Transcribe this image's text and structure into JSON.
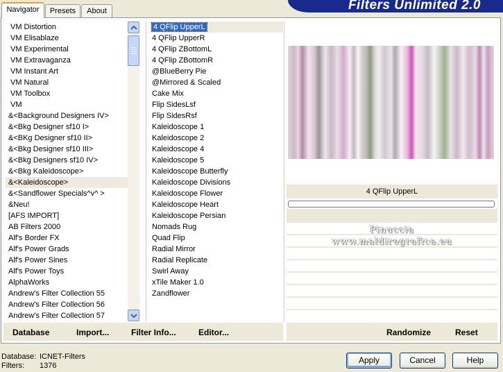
{
  "tabs": [
    {
      "label": "Navigator"
    },
    {
      "label": "Presets"
    },
    {
      "label": "About"
    }
  ],
  "banner": {
    "title": "Filters Unlimited 2.0"
  },
  "categories": {
    "selected_index": 14,
    "items": [
      "VM Distortion",
      "VM Elisablaze",
      "VM Experimental",
      "VM Extravaganza",
      "VM Instant Art",
      "VM Natural",
      "VM Toolbox",
      "VM",
      "&<Background Designers IV>",
      "&<Bkg Designer sf10 I>",
      "&<BKg Designer sf10 II>",
      "&<Bkg Designer sf10 III>",
      "&<Bkg Designers sf10 IV>",
      "&<Bkg Kaleidoscope>",
      "&<Kaleidoscope>",
      "&<Sandflower Specials^v^ >",
      "&Neu!",
      "[AFS IMPORT]",
      "AB Filters 2000",
      "Alf's Border FX",
      "Alf's Power Grads",
      "Alf's Power Sines",
      "Alf's Power Toys",
      "AlphaWorks",
      "Andrew's Filter Collection 55",
      "Andrew's Filter Collection 56",
      "Andrew's Filter Collection 57"
    ]
  },
  "filters": {
    "selected_index": 0,
    "items": [
      "4 QFlip UpperL",
      "4 QFlip UpperR",
      "4 QFlip ZBottomL",
      "4 QFlip ZBottomR",
      "@BlueBerry Pie",
      "@Mirrored & Scaled",
      "Cake Mix",
      "Flip SidesLsf",
      "Flip SidesRsf",
      "Kaleidoscope 1",
      "Kaleidoscope 2",
      "Kaleidoscope 4",
      "Kaleidoscope 5",
      "Kaleidoscope Butterfly",
      "Kaleidoscope Divisions",
      "Kaleidoscope Flower",
      "Kaleidoscope Heart",
      "Kaleidoscope Persian",
      "Nomads Rug",
      "Quad Flip",
      "Radial Mirror",
      "Radial Replicate",
      "Swirl Away",
      "xTile Maker 1.0",
      "Zandflower"
    ]
  },
  "preview": {
    "filter_name": "4 QFlip UpperL",
    "progress": 0
  },
  "watermark": {
    "line1": "Pinuccia",
    "line2": "www.maldiregrafica.eu"
  },
  "left_buttons": {
    "database": "Database",
    "import": "Import...",
    "filter_info": "Filter Info...",
    "editor": "Editor..."
  },
  "right_buttons": {
    "randomize": "Randomize",
    "reset": "Reset"
  },
  "status": {
    "database_label": "Database:",
    "database_value": "ICNET-Filters",
    "filters_label": "Filters:",
    "filters_value": "1376"
  },
  "dialog_buttons": {
    "apply": "Apply",
    "cancel": "Cancel",
    "help": "Help"
  }
}
